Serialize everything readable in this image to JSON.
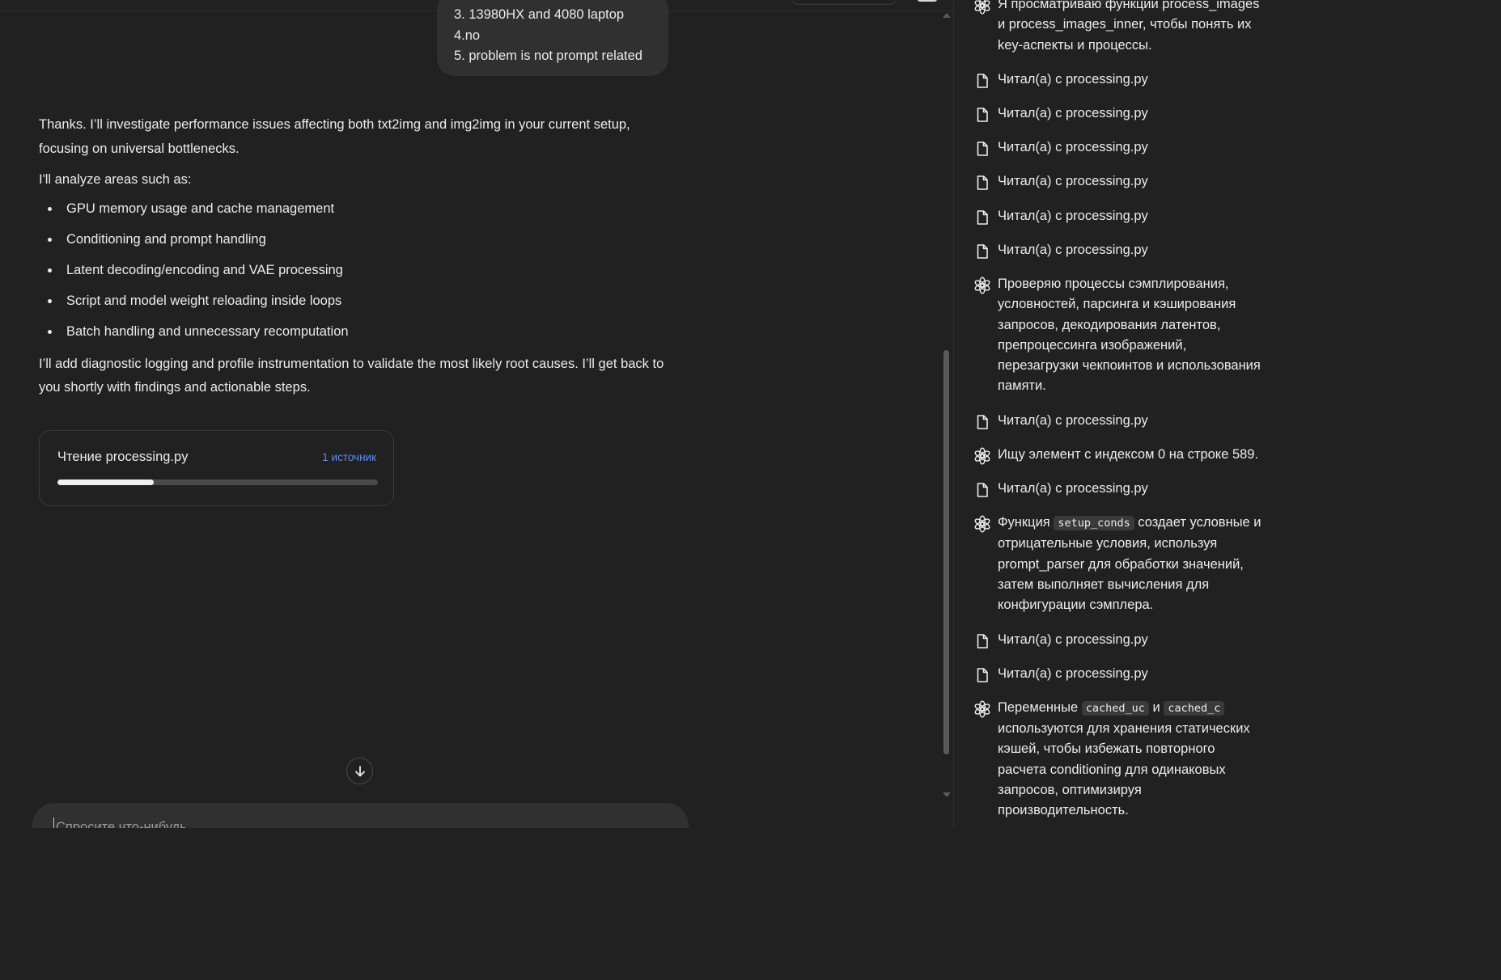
{
  "user_message": {
    "lines": [
      "3. 13980HX and 4080 laptop",
      "4.no",
      "5. problem is not prompt related"
    ]
  },
  "assistant_reply": {
    "intro": "Thanks. I’ll investigate performance issues affecting both txt2img and img2img in your current setup, focusing on universal bottlenecks.",
    "lead": "I'll analyze areas such as:",
    "bullets": [
      "GPU memory usage and cache management",
      "Conditioning and prompt handling",
      "Latent decoding/encoding and VAE processing",
      "Script and model weight reloading inside loops",
      "Batch handling and unnecessary recomputation"
    ],
    "outro": "I’ll add diagnostic logging and profile instrumentation to validate the most likely root causes. I’ll get back to you shortly with findings and actionable steps."
  },
  "progress_card": {
    "title": "Чтение processing.py",
    "sources": "1 источник",
    "progress_fraction": 0.3
  },
  "composer": {
    "placeholder": "Спросите что-нибудь"
  },
  "activity": {
    "items": [
      {
        "type": "thought",
        "segments": [
          {
            "t": "Я просматриваю функции process_images и process_images_inner, чтобы понять их key-аспекты и процессы."
          }
        ]
      },
      {
        "type": "read",
        "segments": [
          {
            "t": "Читал(а) с processing.py"
          }
        ]
      },
      {
        "type": "read",
        "segments": [
          {
            "t": "Читал(а) с processing.py"
          }
        ]
      },
      {
        "type": "read",
        "segments": [
          {
            "t": "Читал(а) с processing.py"
          }
        ]
      },
      {
        "type": "read",
        "segments": [
          {
            "t": "Читал(а) с processing.py"
          }
        ]
      },
      {
        "type": "read",
        "segments": [
          {
            "t": "Читал(а) с processing.py"
          }
        ]
      },
      {
        "type": "read",
        "segments": [
          {
            "t": "Читал(а) с processing.py"
          }
        ]
      },
      {
        "type": "thought",
        "segments": [
          {
            "t": "Проверяю процессы сэмплирования, условностей, парсинга и кэширования запросов, декодирования латентов, препроцессинга изображений, перезагрузки чекпоинтов и использования памяти."
          }
        ]
      },
      {
        "type": "read",
        "segments": [
          {
            "t": "Читал(а) с processing.py"
          }
        ]
      },
      {
        "type": "thought",
        "segments": [
          {
            "t": "Ищу элемент с индексом 0 на строке 589."
          }
        ]
      },
      {
        "type": "read",
        "segments": [
          {
            "t": "Читал(а) с processing.py"
          }
        ]
      },
      {
        "type": "thought",
        "segments": [
          {
            "t": "Функция "
          },
          {
            "code": "setup_conds"
          },
          {
            "t": " создает условные и отрицательные условия, используя prompt_parser для обработки значений, затем выполняет вычисления для конфигурации сэмплера."
          }
        ]
      },
      {
        "type": "read",
        "segments": [
          {
            "t": "Читал(а) с processing.py"
          }
        ]
      },
      {
        "type": "read",
        "segments": [
          {
            "t": "Читал(а) с processing.py"
          }
        ]
      },
      {
        "type": "thought",
        "segments": [
          {
            "t": "Переменные "
          },
          {
            "code": "cached_uc"
          },
          {
            "t": " и "
          },
          {
            "code": "cached_c"
          },
          {
            "t": " используются для хранения статических кэшей, чтобы избежать повторного расчета conditioning для одинаковых запросов, оптимизируя производительность."
          }
        ]
      }
    ]
  },
  "colors": {
    "background": "#212121",
    "bubble": "#303030",
    "text": "#ececec",
    "link": "#5b8def"
  },
  "icons": {
    "read": "file-icon",
    "thought": "openai-logo-icon",
    "scroll": "arrow-down-icon"
  }
}
